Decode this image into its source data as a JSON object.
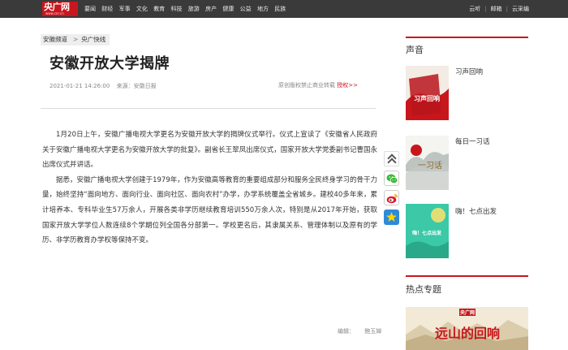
{
  "logo": {
    "text": "央广网",
    "sub": "www.cnr.cn"
  },
  "nav": {
    "items": [
      "要闻",
      "财经",
      "军事",
      "文化",
      "教育",
      "科技",
      "旅游",
      "房产",
      "健康",
      "公益",
      "地方",
      "民族"
    ],
    "right": [
      "云听",
      "邮箱",
      "云采编"
    ]
  },
  "breadcrumb": {
    "channel": "安徽频道",
    "arrow": ">",
    "section": "央广快线"
  },
  "article": {
    "title": "安徽开放大学揭牌",
    "datetime": "2021-01-21 14:26:00",
    "source": "来源：安徽日报",
    "copyright": "原创版权禁止商业转载",
    "copyright_link": "授权>>",
    "paragraphs": [
      "1月20日上午，安徽广播电视大学更名为安徽开放大学的揭牌仪式举行。仪式上宣读了《安徽省人民政府关于安徽广播电视大学更名为安徽开放大学的批复》。副省长王翠凤出席仪式，国家开放大学党委副书记曹国永出席仪式并讲话。",
      "据悉，安徽广播电视大学创建于1979年，作为安徽高等教育的重要组成部分和服务全民终身学习的骨干力量，始终坚持“面向地方、面向行业、面向社区、面向农村”办学，办学系统覆盖全省城乡。建校40多年来，累计培养本、专科毕业生57万余人，开展各类非学历继续教育培训550万余人次，特别是从2017年开始，获取国家开放大学学位人数连续8个学期位列全国各分部第一。学校更名后，其隶属关系、管理体制以及原有的学历、非学历教育办学权等保持不变。"
    ],
    "editor_label": "编辑：",
    "editor_name": "鲍玉婵"
  },
  "share": {
    "icons": [
      "back-to-top-icon",
      "wechat-icon",
      "weibo-icon",
      "qzone-icon"
    ]
  },
  "sidebar": {
    "voice_title": "声音",
    "voice_items": [
      {
        "label": "习声回响",
        "thumb_text": "习声回响"
      },
      {
        "label": "每日一习话",
        "thumb_text": "一习话"
      },
      {
        "label": "嗨！七点出发",
        "thumb_text": "嗨！七点出发"
      }
    ],
    "hot_title": "热点专题",
    "banner": {
      "logo": "央广网",
      "text": "远山的回响"
    }
  },
  "colors": {
    "brand": "#c8161d",
    "nav_bg": "#3a3a3a"
  }
}
